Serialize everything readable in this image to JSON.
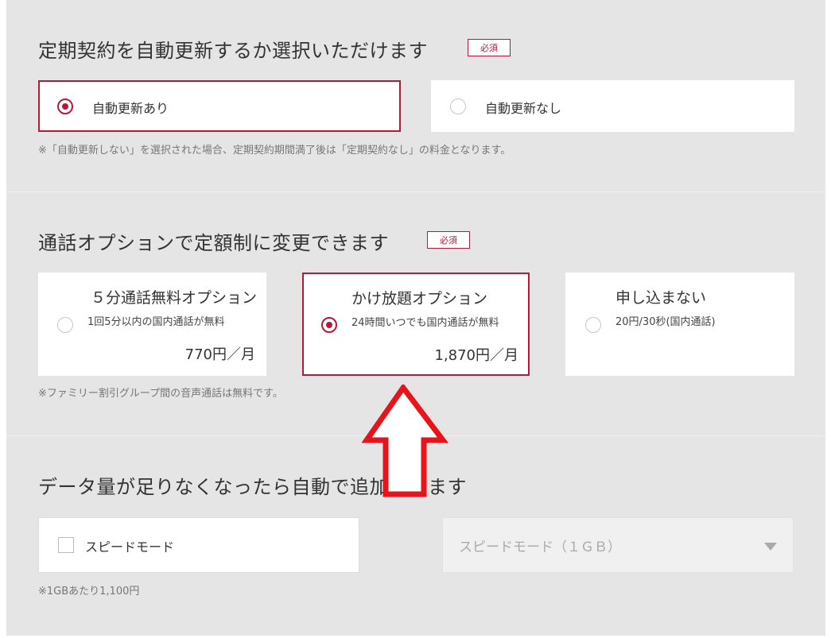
{
  "required_badge": "必須",
  "auto_renew": {
    "heading": "定期契約を自動更新するか選択いただけます",
    "options": [
      {
        "label": "自動更新あり",
        "selected": true
      },
      {
        "label": "自動更新なし",
        "selected": false
      }
    ],
    "note": "※「自動更新しない」を選択された場合、定期契約期間満了後は「定期契約なし」の料金となります。"
  },
  "call_option": {
    "heading": "通話オプションで定額制に変更できます",
    "options": [
      {
        "title": "５分通話無料オプション",
        "desc": "1回5分以内の国内通話が無料",
        "price": "770円／月",
        "selected": false
      },
      {
        "title": "かけ放題オプション",
        "desc": "24時間いつでも国内通話が無料",
        "price": "1,870円／月",
        "selected": true
      },
      {
        "title": "申し込まない",
        "desc": "20円/30秒(国内通話)",
        "price": "",
        "selected": false
      }
    ],
    "note": "※ファミリー割引グループ間の音声通話は無料です。"
  },
  "data_topup": {
    "heading": "データ量が足りなくなったら自動で追加できます",
    "checkbox_label": "スピードモード",
    "checked": false,
    "select_value": "スピードモード（１ＧＢ）",
    "note": "※1GBあたり1,100円"
  },
  "annotation": {
    "arrow_color": "#e8141c"
  },
  "colors": {
    "accent": "#b5193a",
    "panel_bg": "#e5e5e5"
  }
}
